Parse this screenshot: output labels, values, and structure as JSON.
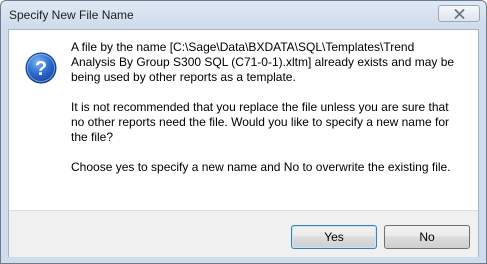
{
  "window": {
    "title": "Specify New File Name"
  },
  "icons": {
    "dialog": "question-icon",
    "close": "close-icon"
  },
  "message": {
    "paragraphs": [
      "A file by the name [C:\\Sage\\Data\\BXDATA\\SQL\\Templates\\Trend Analysis By Group S300 SQL (C71-0-1).xltm] already exists and may be being used by other reports as a template.",
      "It is not recommended that you replace the file unless you are sure that no other reports need the file. Would you like to specify a new name for the file?",
      "Choose yes to specify a new name and No to overwrite the existing file."
    ]
  },
  "buttons": {
    "yes_label": "Yes",
    "no_label": "No"
  },
  "colors": {
    "icon_blue": "#1f5fbf",
    "titlebar": "#dfe9f5"
  }
}
